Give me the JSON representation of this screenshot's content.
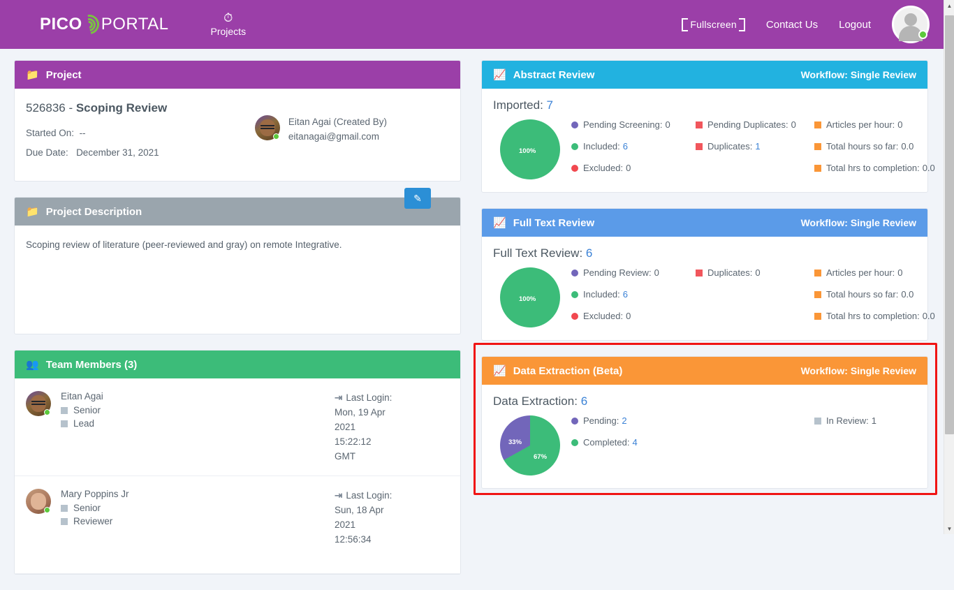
{
  "header": {
    "logo_pico": "PICO",
    "logo_portal": "PORTAL",
    "nav_projects": "Projects",
    "gauge_icon": "gauge-icon",
    "fullscreen": "Fullscreen",
    "contact_us": "Contact Us",
    "logout": "Logout",
    "brand_color": "#9b3fa8",
    "accent_green": "#7ac143"
  },
  "project": {
    "panel_title": "Project",
    "title_id": "526836",
    "title_sep": " - ",
    "title_name": "Scoping Review",
    "started_on_label": "Started On:",
    "started_on_value": "--",
    "due_date_label": "Due Date:",
    "due_date_value": "December 31, 2021",
    "owner_name": "Eitan Agai (Created By)",
    "owner_email": "eitanagai@gmail.com"
  },
  "description": {
    "panel_title": "Project Description",
    "text": "Scoping review of literature (peer-reviewed and gray) on remote Integrative."
  },
  "team": {
    "panel_title": "Team Members (3)",
    "members": [
      {
        "name": "Eitan Agai",
        "roles": [
          "Senior",
          "Lead"
        ],
        "login_label": "Last Login:",
        "login_value": "Mon, 19 Apr 2021 15:22:12 GMT"
      },
      {
        "name": "Mary Poppins Jr",
        "roles": [
          "Senior",
          "Reviewer"
        ],
        "login_label": "Last Login:",
        "login_value": "Sun, 18 Apr 2021 12:56:34"
      }
    ],
    "edit_icon": "edit-pencil-icon"
  },
  "abstract_review": {
    "panel_title": "Abstract Review",
    "workflow": "Workflow: Single Review",
    "header_color": "#22b2e0",
    "count_label": "Imported:",
    "count_value": "7",
    "pie_label": "100%",
    "legend": [
      [
        {
          "label": "Pending Screening:",
          "value": "0",
          "color": "#7266ba",
          "shape": "circle"
        },
        {
          "label": "Included:",
          "value": "6",
          "color": "#3cbc79",
          "shape": "circle"
        },
        {
          "label": "Excluded:",
          "value": "0",
          "color": "#f1484f",
          "shape": "circle"
        }
      ],
      [
        {
          "label": "Pending Duplicates:",
          "value": "0",
          "color": "#f1565c",
          "shape": "square"
        },
        {
          "label": "Duplicates:",
          "value": "1",
          "color": "#f1565c",
          "shape": "square"
        }
      ],
      [
        {
          "label": "Articles per hour:",
          "value": "0",
          "color": "#fa9637",
          "shape": "square"
        },
        {
          "label": "Total hours so far:",
          "value": "0.0",
          "color": "#fa9637",
          "shape": "square"
        },
        {
          "label": "Total hrs to completion:",
          "value": "0.0",
          "color": "#fa9637",
          "shape": "square"
        }
      ]
    ]
  },
  "full_text_review": {
    "panel_title": "Full Text Review",
    "workflow": "Workflow: Single Review",
    "header_color": "#5b9be8",
    "count_label": "Full Text Review:",
    "count_value": "6",
    "pie_label": "100%",
    "legend": [
      [
        {
          "label": "Pending Review:",
          "value": "0",
          "color": "#7266ba",
          "shape": "circle"
        },
        {
          "label": "Included:",
          "value": "6",
          "color": "#3cbc79",
          "shape": "circle"
        },
        {
          "label": "Excluded:",
          "value": "0",
          "color": "#f1484f",
          "shape": "circle"
        }
      ],
      [
        {
          "label": "Duplicates:",
          "value": "0",
          "color": "#f1565c",
          "shape": "square"
        }
      ],
      [
        {
          "label": "Articles per hour:",
          "value": "0",
          "color": "#fa9637",
          "shape": "square"
        },
        {
          "label": "Total hours so far:",
          "value": "0.0",
          "color": "#fa9637",
          "shape": "square"
        },
        {
          "label": "Total hrs to completion:",
          "value": "0.0",
          "color": "#fa9637",
          "shape": "square"
        }
      ]
    ]
  },
  "data_extraction": {
    "panel_title": "Data Extraction (Beta)",
    "workflow": "Workflow: Single Review",
    "header_color": "#fa9637",
    "count_label": "Data Extraction:",
    "count_value": "6",
    "pie_label_a": "33%",
    "pie_label_b": "67%",
    "highlight_color": "#f01414",
    "legend": [
      [
        {
          "label": "Pending:",
          "value": "2",
          "color": "#7266ba",
          "shape": "circle"
        },
        {
          "label": "Completed:",
          "value": "4",
          "color": "#3cbc79",
          "shape": "circle"
        }
      ],
      [
        {
          "label": "In Review:",
          "value": "1",
          "color": "#b6c2cc",
          "shape": "square"
        }
      ]
    ]
  },
  "chart_data": [
    {
      "type": "pie",
      "title": "Abstract Review",
      "categories": [
        "Included"
      ],
      "values": [
        100
      ],
      "labels": [
        "100%"
      ],
      "colors": [
        "#3cbc79"
      ]
    },
    {
      "type": "pie",
      "title": "Full Text Review",
      "categories": [
        "Included"
      ],
      "values": [
        100
      ],
      "labels": [
        "100%"
      ],
      "colors": [
        "#3cbc79"
      ]
    },
    {
      "type": "pie",
      "title": "Data Extraction",
      "categories": [
        "Completed",
        "Pending"
      ],
      "values": [
        67,
        33
      ],
      "labels": [
        "67%",
        "33%"
      ],
      "colors": [
        "#3cbc79",
        "#7266ba"
      ]
    }
  ]
}
